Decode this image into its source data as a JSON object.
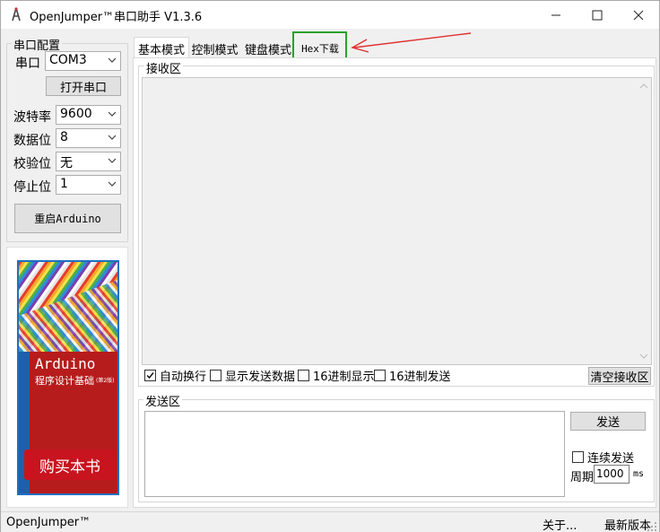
{
  "window": {
    "title": "OpenJumper™串口助手  V1.3.6",
    "minimize": "—",
    "maximize": "☐",
    "close": "✕"
  },
  "port_config": {
    "group_title": "串口配置",
    "port_label": "串口",
    "port_value": "COM3",
    "open_button": "打开串口",
    "baud_label": "波特率",
    "baud_value": "9600",
    "databits_label": "数据位",
    "databits_value": "8",
    "parity_label": "校验位",
    "parity_value": "无",
    "stopbits_label": "停止位",
    "stopbits_value": "1",
    "restart_button": "重启Arduino"
  },
  "ad": {
    "book_title": "Arduino",
    "book_subtitle": "程序设计基础",
    "edition": "(第2版)",
    "buy_button": "购买本书"
  },
  "tabs": [
    {
      "label": "基本模式"
    },
    {
      "label": "控制模式"
    },
    {
      "label": "键盘模式"
    },
    {
      "label": "Hex下载"
    }
  ],
  "receive": {
    "group_title": "接收区",
    "auto_wrap": "自动换行",
    "show_sent": "显示发送数据",
    "hex_display": "16进制显示",
    "hex_send": "16进制发送",
    "clear_button": "清空接收区"
  },
  "send": {
    "group_title": "发送区",
    "send_button": "发送",
    "continuous": "连续发送",
    "period_label": "周期",
    "period_value": "1000",
    "period_unit": "ms"
  },
  "status": {
    "left": "OpenJumper™",
    "about": "关于...",
    "latest": "最新版本"
  },
  "colors": {
    "highlight_box": "#2ca02c",
    "annotation_arrow": "#e03030",
    "buy_button": "#c8141e"
  }
}
